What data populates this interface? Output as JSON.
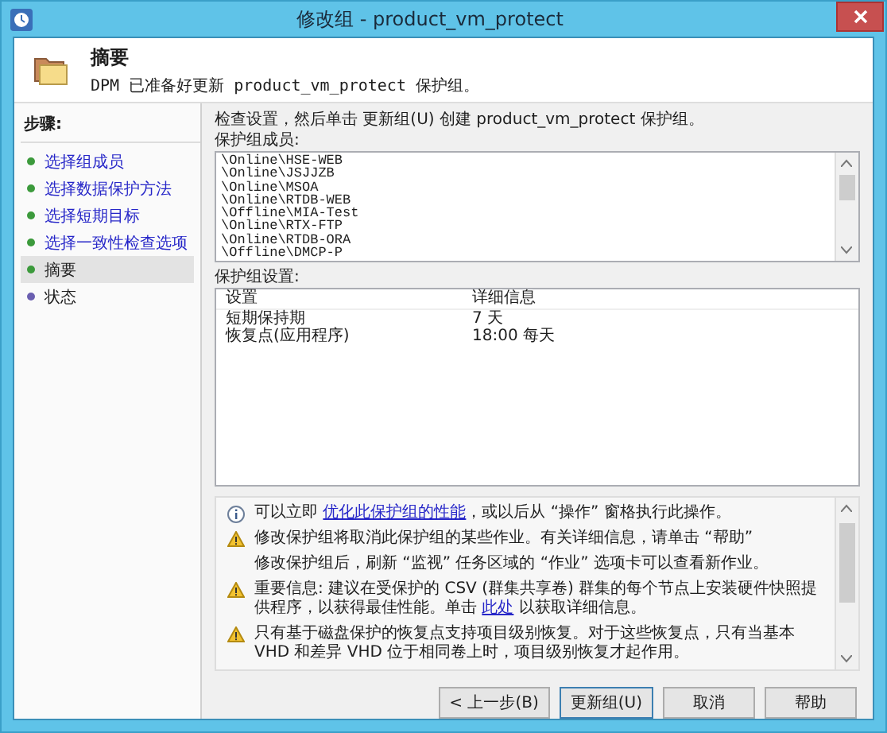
{
  "window": {
    "title": "修改组 - product_vm_protect"
  },
  "header": {
    "title": "摘要",
    "subtitle": "DPM 已准备好更新 product_vm_protect 保护组。"
  },
  "steps": {
    "title": "步骤:",
    "items": [
      {
        "label": "选择组成员",
        "completed": true,
        "selected": false
      },
      {
        "label": "选择数据保护方法",
        "completed": true,
        "selected": false
      },
      {
        "label": "选择短期目标",
        "completed": true,
        "selected": false
      },
      {
        "label": "选择一致性检查选项",
        "completed": true,
        "selected": false
      },
      {
        "label": "摘要",
        "completed": true,
        "selected": true
      },
      {
        "label": "状态",
        "completed": false,
        "selected": false
      }
    ]
  },
  "instruction": "检查设置，然后单击 更新组(U) 创建 product_vm_protect 保护组。",
  "members": {
    "label": "保护组成员:",
    "items": [
      "\\Online\\HSE-WEB",
      "\\Online\\JSJJZB",
      "\\Online\\MSOA",
      "\\Online\\RTDB-WEB",
      "\\Offline\\MIA-Test",
      "\\Online\\RTX-FTP",
      "\\Online\\RTDB-ORA",
      "\\Offline\\DMCP-P"
    ]
  },
  "settings": {
    "label": "保护组设置:",
    "columns": [
      "设置",
      "详细信息"
    ],
    "rows": [
      [
        "短期保持期",
        "7 天"
      ],
      [
        "恢复点(应用程序)",
        "18:00 每天"
      ]
    ]
  },
  "messages": [
    {
      "kind": "info",
      "parts": [
        {
          "text": "可以立即 ",
          "link": false
        },
        {
          "text": "优化此保护组的性能",
          "link": true
        },
        {
          "text": "，或以后从 “操作” 窗格执行此操作。",
          "link": false
        }
      ]
    },
    {
      "kind": "warning",
      "parts": [
        {
          "text": "修改保护组将取消此保护组的某些作业。有关详细信息，请单击 “帮助”",
          "link": false
        }
      ]
    },
    {
      "kind": "plain",
      "parts": [
        {
          "text": "修改保护组后，刷新 “监视” 任务区域的 “作业” 选项卡可以查看新作业。",
          "link": false
        }
      ]
    },
    {
      "kind": "warning",
      "parts": [
        {
          "text": "重要信息:    建议在受保护的 CSV (群集共享卷) 群集的每个节点上安装硬件快照提供程序，以获得最佳性能。单击 ",
          "link": false
        },
        {
          "text": "此处",
          "link": true
        },
        {
          "text": " 以获取详细信息。",
          "link": false
        }
      ]
    },
    {
      "kind": "warning",
      "parts": [
        {
          "text": "只有基于磁盘保护的恢复点支持项目级别恢复。对于这些恢复点，只有当基本 VHD 和差异 VHD 位于相同卷上时，项目级别恢复才起作用。",
          "link": false
        }
      ]
    }
  ],
  "buttons": [
    {
      "label": "< 上一步(B)",
      "default": false
    },
    {
      "label": "更新组(U)",
      "default": true
    },
    {
      "label": "取消",
      "default": false
    },
    {
      "label": "帮助",
      "default": false
    }
  ]
}
